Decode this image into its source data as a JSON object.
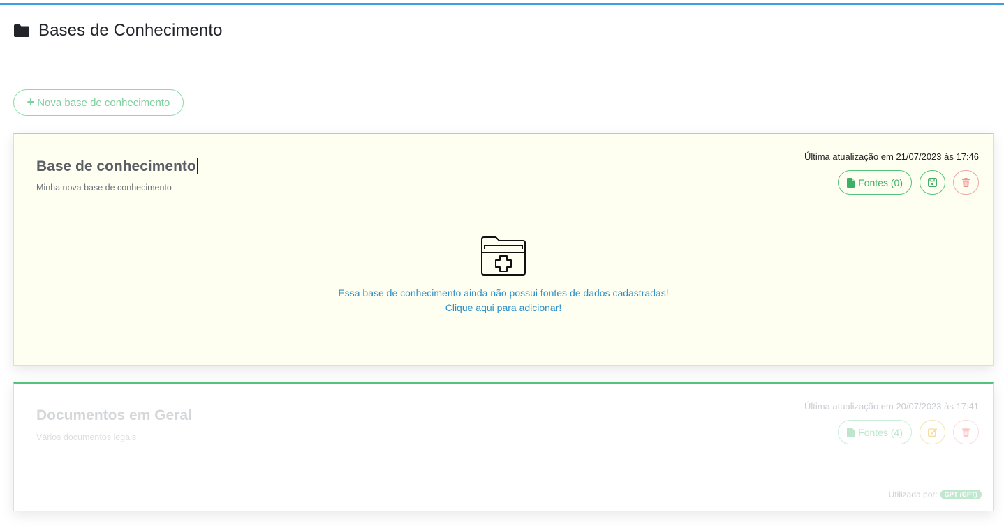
{
  "header": {
    "title": "Bases de Conhecimento",
    "icon": "folder-icon"
  },
  "toolbar": {
    "new_label": "Nova base de conhecimento",
    "new_icon": "plus-icon"
  },
  "cards": [
    {
      "title": "Base de conhecimento",
      "description": "Minha nova base de conhecimento",
      "updated": "Última atualização em 21/07/2023 às 17:46",
      "fontes_label": "Fontes (0)",
      "empty_line1": "Essa base de conhecimento ainda não possui fontes de dados cadastradas!",
      "empty_line2": "Clique aqui para adicionar!",
      "accent": "#f4c545",
      "background": "#fefff0"
    },
    {
      "title": "Documentos em Geral",
      "description": "Vários documentos legais",
      "updated": "Última atualização em 20/07/2023 às 17:41",
      "fontes_label": "Fontes (4)",
      "used_by_label": "Utilizada por:",
      "used_by_tag": "GPT (GPT)",
      "accent": "#53c27a"
    }
  ],
  "colors": {
    "green": "#53c27a",
    "red": "#f3a3a3",
    "blue": "#2c8fc8",
    "top_line": "#3aa0e0"
  }
}
